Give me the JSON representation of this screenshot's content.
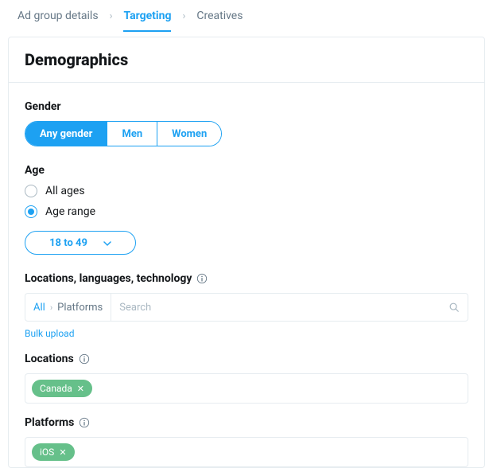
{
  "breadcrumbs": {
    "items": [
      "Ad group details",
      "Targeting",
      "Creatives"
    ],
    "active_index": 1
  },
  "panel": {
    "title": "Demographics"
  },
  "gender": {
    "label": "Gender",
    "options": [
      "Any gender",
      "Men",
      "Women"
    ],
    "selected_index": 0
  },
  "age": {
    "label": "Age",
    "options": [
      "All ages",
      "Age range"
    ],
    "selected_index": 1,
    "range_label": "18 to 49"
  },
  "llt": {
    "label": "Locations, languages, technology",
    "path": [
      "All",
      "Platforms"
    ],
    "search_placeholder": "Search",
    "bulk_upload_label": "Bulk upload"
  },
  "locations": {
    "label": "Locations",
    "tags": [
      "Canada"
    ]
  },
  "platforms": {
    "label": "Platforms",
    "tags": [
      "iOS"
    ]
  },
  "colors": {
    "accent": "#1da1f2",
    "tag": "#66c08a"
  }
}
